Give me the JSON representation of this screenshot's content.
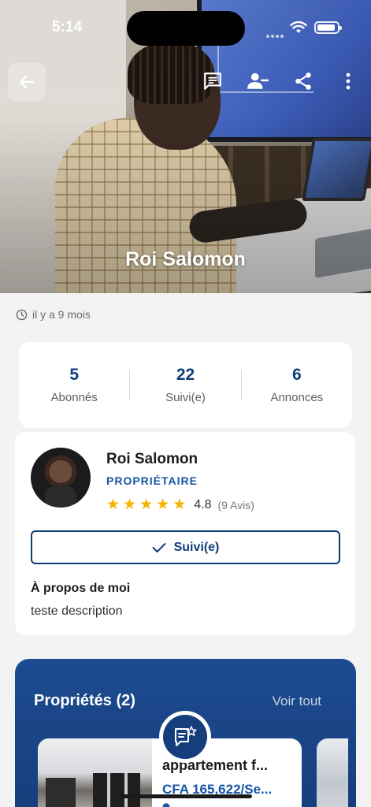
{
  "status_bar": {
    "time": "5:14"
  },
  "hero": {
    "name": "Roi Salomon"
  },
  "header_icons": [
    "back-arrow-icon",
    "chat-icon",
    "person-remove-icon",
    "share-icon",
    "more-vertical-icon"
  ],
  "joined": {
    "text": "il y a 9 mois",
    "icon": "clock-icon"
  },
  "stats": [
    {
      "value": "5",
      "label": "Abonnés"
    },
    {
      "value": "22",
      "label": "Suivi(e)"
    },
    {
      "value": "6",
      "label": "Annonces"
    }
  ],
  "profile": {
    "name": "Roi Salomon",
    "role": "PROPRIÉTAIRE",
    "rating_value": "4.8",
    "rating_stars": 5,
    "rating_count": "(9 Avis)",
    "follow_label": "Suivi(e)",
    "about_title": "À propos de moi",
    "about_text": "teste description"
  },
  "properties": {
    "title": "Propriétés (2)",
    "see_all": "Voir tout",
    "items": [
      {
        "title": "appartement f...",
        "price": "CFA 165,622/Se..."
      }
    ]
  },
  "colors": {
    "primary": "#0e3d7a",
    "accent": "#1656a6",
    "star": "#f4b400",
    "section_bg": "#1d4b91"
  }
}
